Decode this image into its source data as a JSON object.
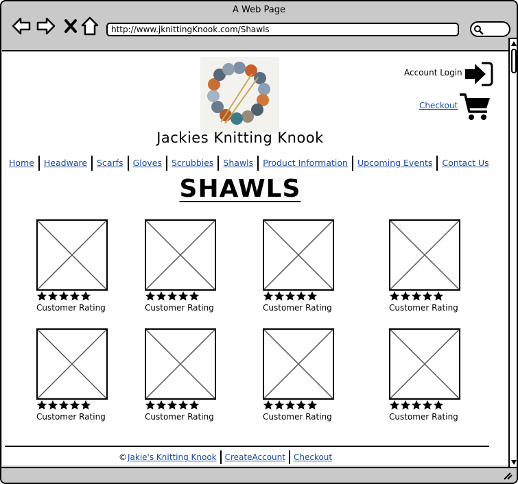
{
  "window": {
    "title": "A Web Page"
  },
  "browser": {
    "url": "http://www.jknittingKnook.com/Shawls"
  },
  "header": {
    "account_login": "Account Login",
    "checkout": "Checkout",
    "site_title": "Jackies Knitting Knook"
  },
  "nav": {
    "items": [
      {
        "label": "Home"
      },
      {
        "label": "Headware"
      },
      {
        "label": "Scarfs"
      },
      {
        "label": "Gloves"
      },
      {
        "label": "Scrubbies"
      },
      {
        "label": "Shawls"
      },
      {
        "label": "Product Information"
      },
      {
        "label": "Upcoming Events"
      },
      {
        "label": "Contact Us"
      }
    ]
  },
  "main": {
    "heading": "SHAWLS",
    "products": [
      {
        "rating_label": "Customer Rating",
        "rating": 5
      },
      {
        "rating_label": "Customer Rating",
        "rating": 5
      },
      {
        "rating_label": "Customer Rating",
        "rating": 5
      },
      {
        "rating_label": "Customer Rating",
        "rating": 5
      },
      {
        "rating_label": "Customer Rating",
        "rating": 5
      },
      {
        "rating_label": "Customer Rating",
        "rating": 5
      },
      {
        "rating_label": "Customer Rating",
        "rating": 5
      },
      {
        "rating_label": "Customer Rating",
        "rating": 5
      }
    ]
  },
  "footer": {
    "copyright_symbol": "©",
    "links": [
      {
        "label": "Jakie's Knitting Knook"
      },
      {
        "label": "CreateAccount"
      },
      {
        "label": "Checkout"
      }
    ]
  },
  "colors": {
    "link": "#1a4a9e",
    "chrome": "#c9c9c9"
  }
}
